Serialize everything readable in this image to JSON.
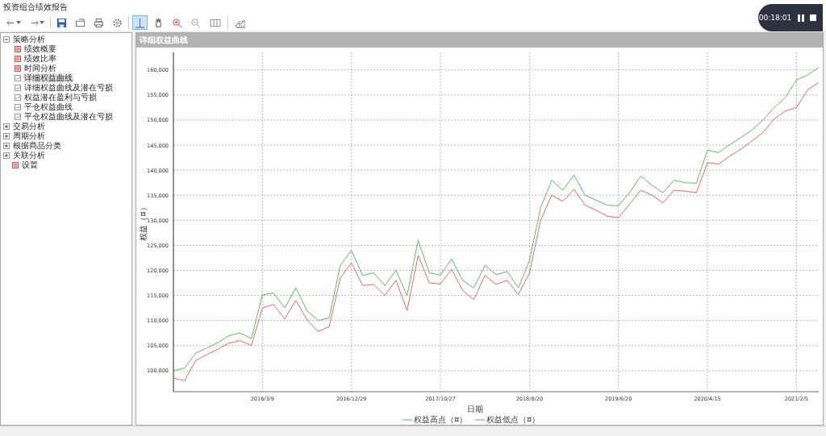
{
  "window": {
    "title": "投资组合绩效报告"
  },
  "recorder": {
    "time": "00:18:01"
  },
  "toolbar": [
    {
      "kind": "back",
      "selected": false
    },
    {
      "kind": "forward",
      "selected": false
    },
    {
      "kind": "save",
      "selected": false
    },
    {
      "kind": "export",
      "selected": false
    },
    {
      "kind": "print",
      "selected": false
    },
    {
      "kind": "settings",
      "selected": false
    },
    {
      "kind": "crosshair",
      "selected": true
    },
    {
      "kind": "hand",
      "selected": false
    },
    {
      "kind": "zoom-in",
      "selected": false
    },
    {
      "kind": "zoom-out",
      "selected": false
    },
    {
      "kind": "columns",
      "selected": false
    },
    {
      "kind": "chart",
      "selected": false
    }
  ],
  "tree": [
    {
      "label": "策略分析",
      "expanded": true,
      "children": [
        {
          "label": "绩效概要",
          "kind": "table",
          "selected": false
        },
        {
          "label": "绩效比率",
          "kind": "table",
          "selected": false
        },
        {
          "label": "时间分析",
          "kind": "table",
          "selected": false
        },
        {
          "label": "详细权益曲线",
          "kind": "chart",
          "selected": true
        },
        {
          "label": "详细权益曲线及潜在亏损",
          "kind": "chart",
          "selected": false
        },
        {
          "label": "权益潜在盈利与亏损",
          "kind": "chart",
          "selected": false
        },
        {
          "label": "平仓权益曲线",
          "kind": "chart",
          "selected": false
        },
        {
          "label": "平仓权益曲线及潜在亏损",
          "kind": "chart",
          "selected": false
        }
      ]
    },
    {
      "label": "交易分析",
      "expanded": false
    },
    {
      "label": "周期分析",
      "expanded": false
    },
    {
      "label": "根据商品分类",
      "expanded": false
    },
    {
      "label": "关联分析",
      "expanded": false
    },
    {
      "label": "设置",
      "kind": "table",
      "selected": false
    }
  ],
  "panel": {
    "title": "详细权益曲线",
    "chart_data": {
      "type": "line",
      "grid": true,
      "legend": "bottom",
      "xlabel": "日期",
      "ylabel": "权益（¤）",
      "ylim": [
        95800,
        163500
      ],
      "yticks": [
        {
          "value": 100000,
          "label": "100,000"
        },
        {
          "value": 105000,
          "label": "105,000"
        },
        {
          "value": 110000,
          "label": "110,000"
        },
        {
          "value": 115000,
          "label": "115,000"
        },
        {
          "value": 120000,
          "label": "120,000"
        },
        {
          "value": 125000,
          "label": "125,000"
        },
        {
          "value": 130000,
          "label": "130,000"
        },
        {
          "value": 135000,
          "label": "135,000"
        },
        {
          "value": 140000,
          "label": "140,000"
        },
        {
          "value": 145000,
          "label": "145,000"
        },
        {
          "value": 150000,
          "label": "150,000"
        },
        {
          "value": 155000,
          "label": "155,000"
        },
        {
          "value": 160000,
          "label": "160,000"
        }
      ],
      "categories": [
        null,
        null,
        null,
        null,
        null,
        null,
        null,
        null,
        "2016/3/9",
        null,
        null,
        null,
        null,
        null,
        null,
        null,
        "2016/12/29",
        null,
        null,
        null,
        null,
        null,
        null,
        null,
        "2017/10/27",
        null,
        null,
        null,
        null,
        null,
        null,
        null,
        "2018/8/20",
        null,
        null,
        null,
        null,
        null,
        null,
        null,
        "2019/6/20",
        null,
        null,
        null,
        null,
        null,
        null,
        null,
        "2020/4/15",
        null,
        null,
        null,
        null,
        null,
        null,
        null,
        "2021/2/5",
        null,
        null
      ],
      "series": [
        {
          "name": "权益高点（¤）",
          "color": "#3aa53a",
          "values": [
            100000,
            100500,
            103500,
            104500,
            105600,
            107000,
            107500,
            106400,
            115100,
            115500,
            112500,
            116500,
            112000,
            110000,
            110500,
            121000,
            124000,
            119000,
            119500,
            117000,
            120000,
            115000,
            126000,
            119500,
            119100,
            122300,
            118000,
            116500,
            121000,
            119100,
            119800,
            116500,
            122000,
            132500,
            138000,
            136000,
            139000,
            135000,
            134000,
            133000,
            132900,
            135500,
            138800,
            137000,
            135500,
            138000,
            137500,
            137400,
            144000,
            143500,
            145100,
            146500,
            148000,
            150000,
            152500,
            154500,
            158000,
            159000,
            160500
          ]
        },
        {
          "name": "权益低点（¤）",
          "color": "#e8403a",
          "values": [
            98500,
            98000,
            102000,
            103200,
            104300,
            105500,
            106000,
            105000,
            112500,
            113200,
            110300,
            114000,
            110200,
            107800,
            108800,
            118500,
            121500,
            117000,
            117200,
            115000,
            118000,
            112000,
            123000,
            117500,
            117300,
            120200,
            116000,
            114200,
            119000,
            117200,
            118000,
            115200,
            119500,
            130000,
            135000,
            133800,
            136200,
            133000,
            132000,
            130800,
            130500,
            133200,
            136000,
            135000,
            133500,
            136000,
            135800,
            135500,
            141500,
            141200,
            142800,
            144200,
            145800,
            147500,
            150200,
            151800,
            152500,
            156000,
            157500
          ]
        }
      ]
    }
  }
}
